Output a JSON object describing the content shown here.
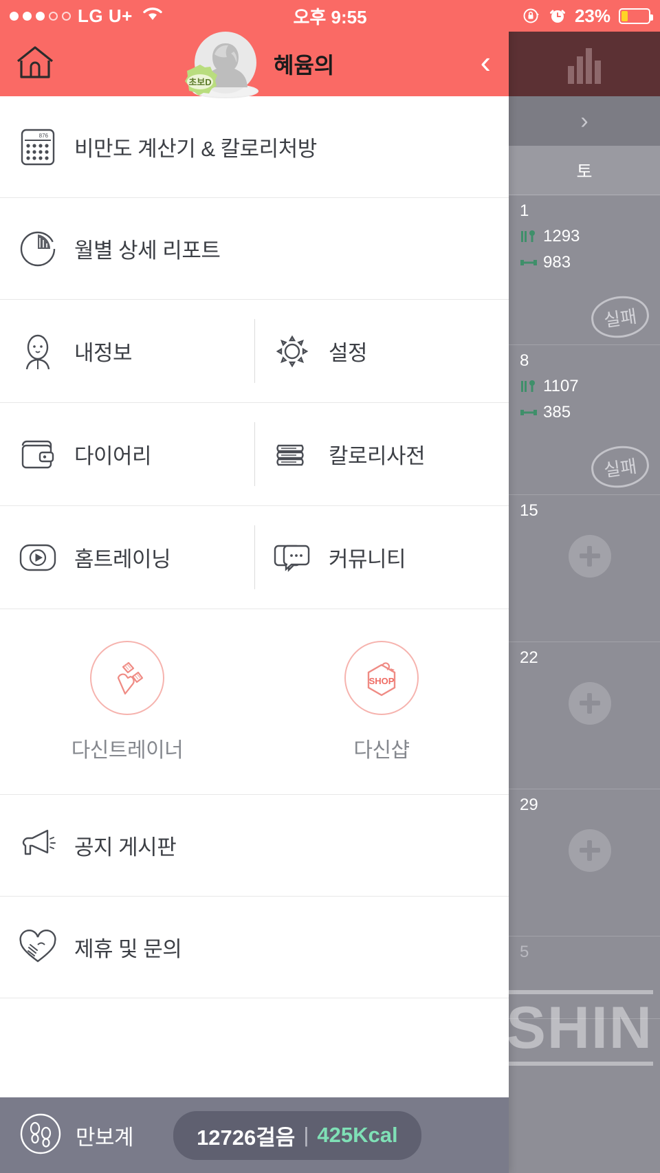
{
  "colors": {
    "accent": "#fa6a65",
    "promo_outline": "#f6b3ae",
    "footer_bg": "#7a7b8a",
    "kcal_green": "#7fe0b6",
    "battery_fill": "#ffd426"
  },
  "status_bar": {
    "carrier": "LG U+",
    "signal_dots_filled": 3,
    "signal_dots_total": 5,
    "wifi_icon": "wifi-icon",
    "time": "오후 9:55",
    "rotation_lock_icon": "rotation-lock-icon",
    "alarm_icon": "alarm-clock-icon",
    "battery_percent": "23%",
    "battery_level": 23
  },
  "header": {
    "home_icon": "home-icon",
    "avatar_icon": "avatar",
    "level_badge": "초보D",
    "username": "혜윰의",
    "back_icon": "chevron-left-icon"
  },
  "menu": {
    "rows": [
      {
        "type": "full",
        "items": [
          {
            "icon": "calculator-icon",
            "icon_display": "876",
            "label": "비만도 계산기 & 칼로리처방"
          }
        ]
      },
      {
        "type": "full",
        "items": [
          {
            "icon": "pie-chart-icon",
            "label": "월별 상세 리포트"
          }
        ]
      },
      {
        "type": "split",
        "items": [
          {
            "icon": "person-icon",
            "label": "내정보"
          },
          {
            "icon": "gear-icon",
            "label": "설정"
          }
        ]
      },
      {
        "type": "split",
        "items": [
          {
            "icon": "wallet-icon",
            "label": "다이어리"
          },
          {
            "icon": "book-stack-icon",
            "label": "칼로리사전"
          }
        ]
      },
      {
        "type": "split",
        "items": [
          {
            "icon": "play-button-icon",
            "label": "홈트레이닝"
          },
          {
            "icon": "chat-bubbles-icon",
            "label": "커뮤니티"
          }
        ]
      }
    ],
    "promos": [
      {
        "icon": "dumbbell-icon",
        "label": "다신트레이너"
      },
      {
        "icon": "shop-tag-icon",
        "icon_text": "SHOP",
        "label": "다신샵"
      }
    ],
    "bottom_rows": [
      {
        "icon": "megaphone-icon",
        "label": "공지 게시판"
      },
      {
        "icon": "handshake-heart-icon",
        "label": "제휴 및 문의"
      }
    ]
  },
  "pedometer": {
    "icon": "footsteps-icon",
    "label": "만보계",
    "steps": "12726걸음",
    "separator": "|",
    "kcal": "425Kcal"
  },
  "background_calendar": {
    "chart_icon": "bar-chart-icon",
    "next_arrow_icon": "chevron-right-icon",
    "weekday": "토",
    "cells": [
      {
        "day": "1",
        "calories": "1293",
        "exercise": "983",
        "stamp": "실패"
      },
      {
        "day": "8",
        "calories": "1107",
        "exercise": "385",
        "stamp": "실패"
      },
      {
        "day": "15",
        "add_icon": "plus-icon"
      },
      {
        "day": "22",
        "add_icon": "plus-icon"
      },
      {
        "day": "29",
        "add_icon": "plus-icon"
      },
      {
        "day": "5"
      }
    ]
  },
  "watermark": {
    "text": "DASHIN"
  }
}
